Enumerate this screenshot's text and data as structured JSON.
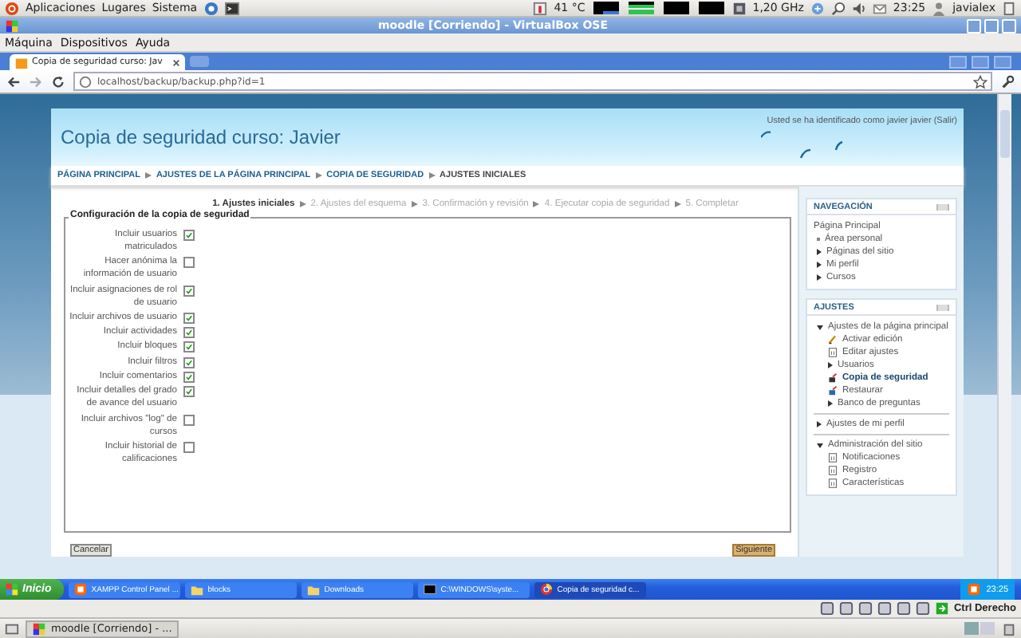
{
  "top_panel": {
    "menus": [
      "Aplicaciones",
      "Lugares",
      "Sistema"
    ],
    "temperature": "41 °C",
    "cpu_freq": "1,20 GHz",
    "clock": "23:25",
    "user": "javialex"
  },
  "vbox": {
    "title": "moodle [Corriendo] - VirtualBox OSE",
    "menus": [
      "Máquina",
      "Dispositivos",
      "Ayuda"
    ]
  },
  "browser": {
    "tabs": [
      {
        "label": "Copia de seguridad curso: Jav",
        "selected": true
      }
    ],
    "url": "localhost/backup/backup.php?id=1"
  },
  "page": {
    "title": "Copia de seguridad curso: Javier",
    "login_info": "Usted se ha identificado como javier javier (Salir)",
    "breadcrumb": [
      {
        "label": "PÁGINA PRINCIPAL",
        "link": true
      },
      {
        "label": "AJUSTES DE LA PÁGINA PRINCIPAL",
        "link": true
      },
      {
        "label": "COPIA DE SEGURIDAD",
        "link": true
      },
      {
        "label": "AJUSTES INICIALES",
        "link": false
      }
    ],
    "steps": [
      {
        "label": "1. Ajustes iniciales",
        "selected": true
      },
      {
        "label": "2. Ajustes del esquema",
        "selected": false
      },
      {
        "label": "3. Confirmación y revisión",
        "selected": false
      },
      {
        "label": "4. Ejecutar copia de seguridad",
        "selected": false
      },
      {
        "label": "5. Completar",
        "selected": false
      }
    ],
    "legend": "Configuración de la copia de seguridad",
    "settings": [
      {
        "label": "Incluir usuarios matriculados",
        "checked": true
      },
      {
        "label": "Hacer anónima la información de usuario",
        "checked": false
      },
      {
        "label": "Incluir asignaciones de rol de usuario",
        "checked": true
      },
      {
        "label": "Incluir archivos de usuario",
        "checked": true
      },
      {
        "label": "Incluir actividades",
        "checked": true
      },
      {
        "label": "Incluir bloques",
        "checked": true
      },
      {
        "label": "Incluir filtros",
        "checked": true
      },
      {
        "label": "Incluir comentarios",
        "checked": true
      },
      {
        "label": "Incluir detalles del grado de avance del usuario",
        "checked": true
      },
      {
        "label": "Incluir archivos \"log\" de cursos",
        "checked": false
      },
      {
        "label": "Incluir historial de calificaciones",
        "checked": false
      }
    ],
    "cancel": "Cancelar",
    "next": "Siguiente"
  },
  "navigation": {
    "title": "NAVEGACIÓN",
    "home": "Página Principal",
    "items": [
      {
        "label": "Área personal",
        "kind": "bullet"
      },
      {
        "label": "Páginas del sitio",
        "kind": "collapsed"
      },
      {
        "label": "Mi perfil",
        "kind": "collapsed"
      },
      {
        "label": "Cursos",
        "kind": "collapsed"
      }
    ]
  },
  "settings_block": {
    "title": "AJUSTES",
    "sections": [
      {
        "label": "Ajustes de la página principal",
        "kind": "expanded",
        "children": [
          {
            "label": "Activar edición",
            "kind": "edit",
            "selected": false
          },
          {
            "label": "Editar ajustes",
            "kind": "page",
            "selected": false
          },
          {
            "label": "Usuarios",
            "kind": "collapsed",
            "selected": false
          },
          {
            "label": "Copia de seguridad",
            "kind": "backup",
            "selected": true
          },
          {
            "label": "Restaurar",
            "kind": "restore",
            "selected": false
          },
          {
            "label": "Banco de preguntas",
            "kind": "collapsed",
            "selected": false
          }
        ]
      },
      {
        "label": "Ajustes de mi perfil",
        "kind": "collapsed"
      },
      {
        "label": "Administración del sitio",
        "kind": "expanded",
        "children": [
          {
            "label": "Notificaciones",
            "kind": "page",
            "selected": false
          },
          {
            "label": "Registro",
            "kind": "page",
            "selected": false
          },
          {
            "label": "Características",
            "kind": "page",
            "selected": false
          }
        ]
      }
    ]
  },
  "taskbar": {
    "start": "Inicio",
    "items": [
      {
        "label": "XAMPP Control Panel ...",
        "kind": "xampp",
        "selected": false
      },
      {
        "label": "blocks",
        "kind": "folder",
        "selected": false
      },
      {
        "label": "Downloads",
        "kind": "folder",
        "selected": false
      },
      {
        "label": "C:\\WINDOWS\\syste...",
        "kind": "console",
        "selected": false
      },
      {
        "label": "Copia de seguridad c...",
        "kind": "browser",
        "selected": true
      }
    ],
    "clock": "23:25"
  },
  "vbox_status": {
    "host_key": "Ctrl Derecho"
  },
  "bottom_panel": {
    "items": [
      "moodle [Corriendo] - ..."
    ]
  }
}
